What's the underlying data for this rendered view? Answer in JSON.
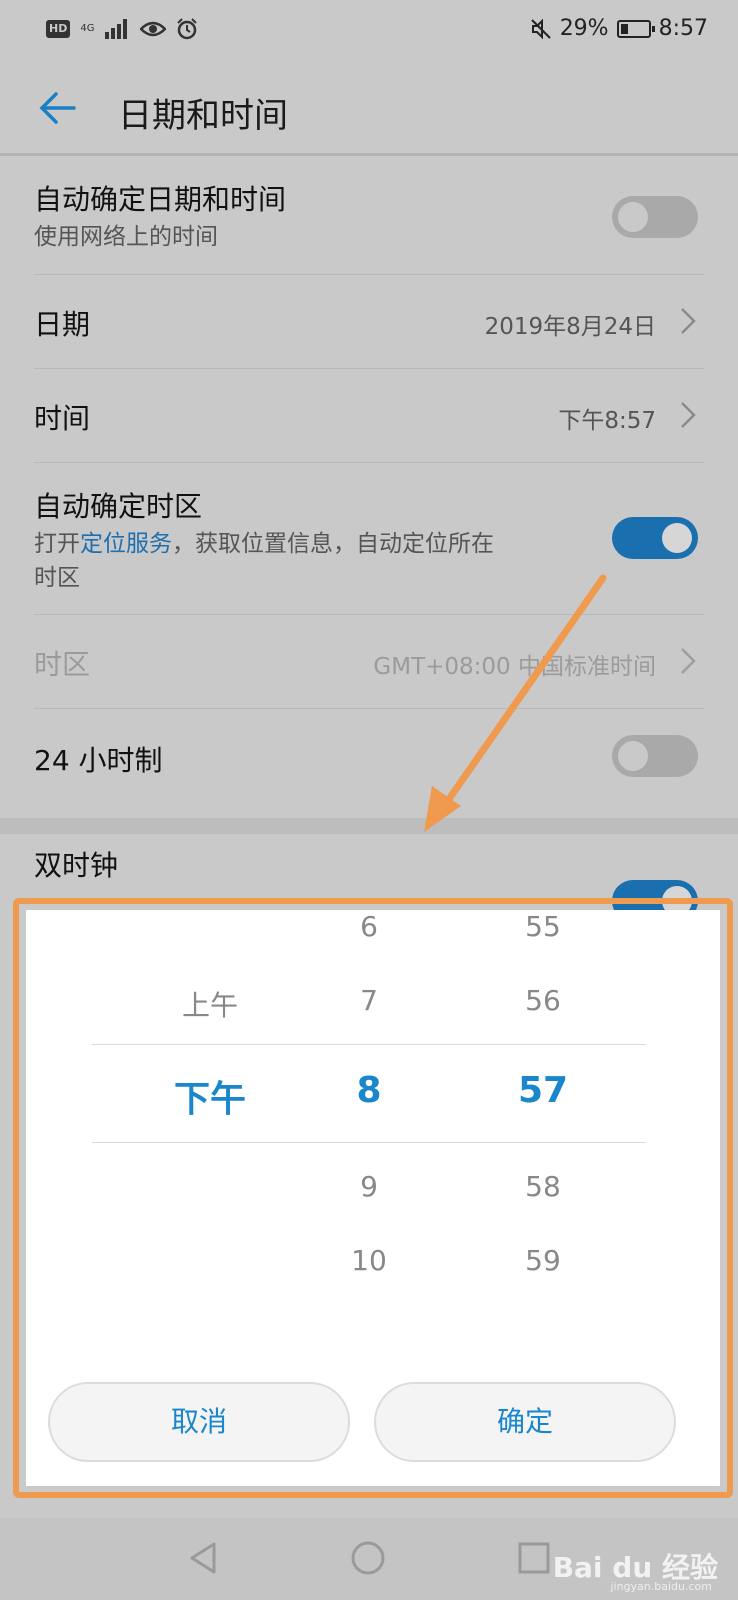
{
  "status_bar": {
    "hd": "HD",
    "network": "4G",
    "battery_percent": "29%",
    "battery_level": 0.29,
    "time": "8:57"
  },
  "header": {
    "title": "日期和时间",
    "back_icon": "back-arrow-icon"
  },
  "settings": {
    "auto_datetime": {
      "title": "自动确定日期和时间",
      "subtitle": "使用网络上的时间",
      "enabled": false
    },
    "date": {
      "title": "日期",
      "value": "2019年8月24日"
    },
    "time": {
      "title": "时间",
      "value": "下午8:57"
    },
    "auto_timezone": {
      "title": "自动确定时区",
      "subtitle_prefix": "打开",
      "subtitle_link": "定位服务",
      "subtitle_suffix": "，获取位置信息，自动定位所在",
      "subtitle_line2": "时区",
      "enabled": true
    },
    "timezone": {
      "title": "时区",
      "value": "GMT+08:00 中国标准时间"
    },
    "hour24": {
      "title": "24 小时制",
      "enabled": false
    },
    "dual_clock": {
      "title": "双时钟",
      "enabled": true
    }
  },
  "picker": {
    "ampm": {
      "above": "上午",
      "selected": "下午"
    },
    "hour": {
      "above2": "6",
      "above1": "7",
      "selected": "8",
      "below1": "9",
      "below2": "10"
    },
    "minute": {
      "above2": "55",
      "above1": "56",
      "selected": "57",
      "below1": "58",
      "below2": "59"
    },
    "cancel_label": "取消",
    "confirm_label": "确定"
  },
  "nav_bar": {
    "back": "nav-back-icon",
    "home": "nav-home-icon",
    "recents": "nav-recents-icon"
  },
  "watermark": {
    "brand": "Bai du 经验",
    "url": "jingyan.baidu.com"
  },
  "colors": {
    "accent": "#1a86cc",
    "highlight_frame": "#ef9a4e",
    "arrow": "#ef9a4e",
    "toggle_on": "#1a6fae"
  }
}
